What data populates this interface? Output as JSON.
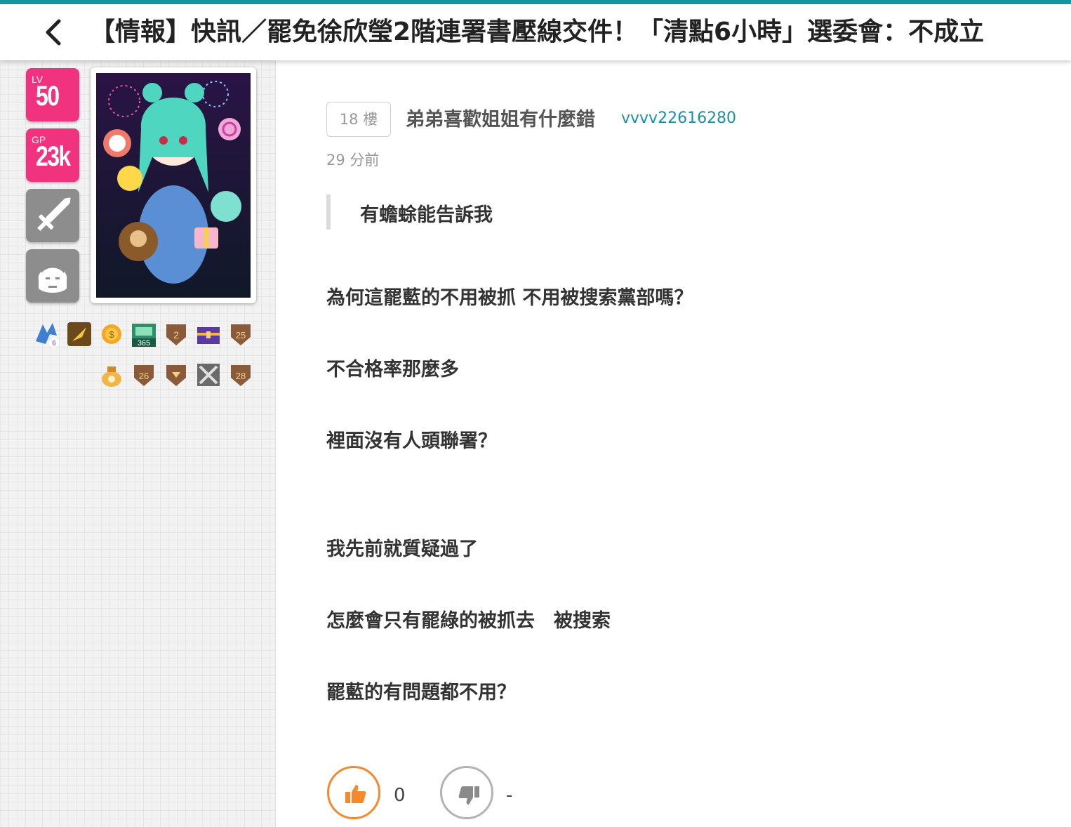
{
  "header": {
    "title": "【情報】快訊／罷免徐欣瑩2階連署書壓線交件！「清點6小時」選委會：不成立"
  },
  "sidebar": {
    "level_label": "LV",
    "level_value": "50",
    "gp_label": "GP",
    "gp_value": "23k",
    "class_icon": "sword-icon",
    "race_icon": "face-icon",
    "badges": [
      "6",
      "365",
      "2",
      "25",
      "26",
      "28"
    ]
  },
  "post": {
    "floor": "18 樓",
    "username": "弟弟喜歡姐姐有什麼錯",
    "user_id": "vvvv22616280",
    "time": "29 分前",
    "quote": "有蟾蜍能告訴我",
    "lines": [
      "為何這罷藍的不用被抓 不用被搜索黨部嗎？",
      "不合格率那麼多",
      "裡面沒有人頭聯署？",
      "我先前就質疑過了",
      "怎麼會只有罷綠的被抓去　被搜索",
      "罷藍的有問題都不用？"
    ]
  },
  "votes": {
    "up_count": "0",
    "down_count": "-"
  },
  "colors": {
    "accent": "#14969f",
    "stat_pink": "#f0327f",
    "like_orange": "#f58a2d",
    "link_teal": "#1b8fa6"
  }
}
